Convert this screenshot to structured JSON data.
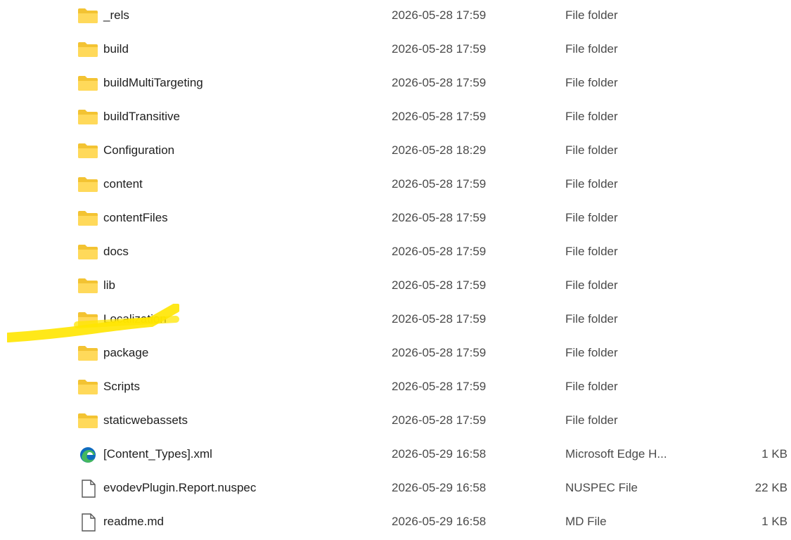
{
  "colors": {
    "folder_body": "#f3c332",
    "folder_front": "#ffd95a",
    "highlight": "#ffe600",
    "edge_blue": "#0f6bbf",
    "edge_green": "#44b85f"
  },
  "files": [
    {
      "name": "_rels",
      "date": "2026-05-28 17:59",
      "type": "File folder",
      "size": "",
      "icon": "folder-icon"
    },
    {
      "name": "build",
      "date": "2026-05-28 17:59",
      "type": "File folder",
      "size": "",
      "icon": "folder-icon"
    },
    {
      "name": "buildMultiTargeting",
      "date": "2026-05-28 17:59",
      "type": "File folder",
      "size": "",
      "icon": "folder-icon"
    },
    {
      "name": "buildTransitive",
      "date": "2026-05-28 17:59",
      "type": "File folder",
      "size": "",
      "icon": "folder-icon"
    },
    {
      "name": "Configuration",
      "date": "2026-05-28 18:29",
      "type": "File folder",
      "size": "",
      "icon": "folder-icon"
    },
    {
      "name": "content",
      "date": "2026-05-28 17:59",
      "type": "File folder",
      "size": "",
      "icon": "folder-icon"
    },
    {
      "name": "contentFiles",
      "date": "2026-05-28 17:59",
      "type": "File folder",
      "size": "",
      "icon": "folder-icon"
    },
    {
      "name": "docs",
      "date": "2026-05-28 17:59",
      "type": "File folder",
      "size": "",
      "icon": "folder-icon"
    },
    {
      "name": "lib",
      "date": "2026-05-28 17:59",
      "type": "File folder",
      "size": "",
      "icon": "folder-icon"
    },
    {
      "name": "Localization",
      "date": "2026-05-28 17:59",
      "type": "File folder",
      "size": "",
      "icon": "folder-icon"
    },
    {
      "name": "package",
      "date": "2026-05-28 17:59",
      "type": "File folder",
      "size": "",
      "icon": "folder-icon"
    },
    {
      "name": "Scripts",
      "date": "2026-05-28 17:59",
      "type": "File folder",
      "size": "",
      "icon": "folder-icon"
    },
    {
      "name": "staticwebassets",
      "date": "2026-05-28 17:59",
      "type": "File folder",
      "size": "",
      "icon": "folder-icon"
    },
    {
      "name": "[Content_Types].xml",
      "date": "2026-05-29 16:58",
      "type": "Microsoft Edge H...",
      "size": "1 KB",
      "icon": "edge-icon"
    },
    {
      "name": "evodevPlugin.Report.nuspec",
      "date": "2026-05-29 16:58",
      "type": "NUSPEC File",
      "size": "22 KB",
      "icon": "file-icon"
    },
    {
      "name": "readme.md",
      "date": "2026-05-29 16:58",
      "type": "MD File",
      "size": "1 KB",
      "icon": "file-icon"
    }
  ]
}
